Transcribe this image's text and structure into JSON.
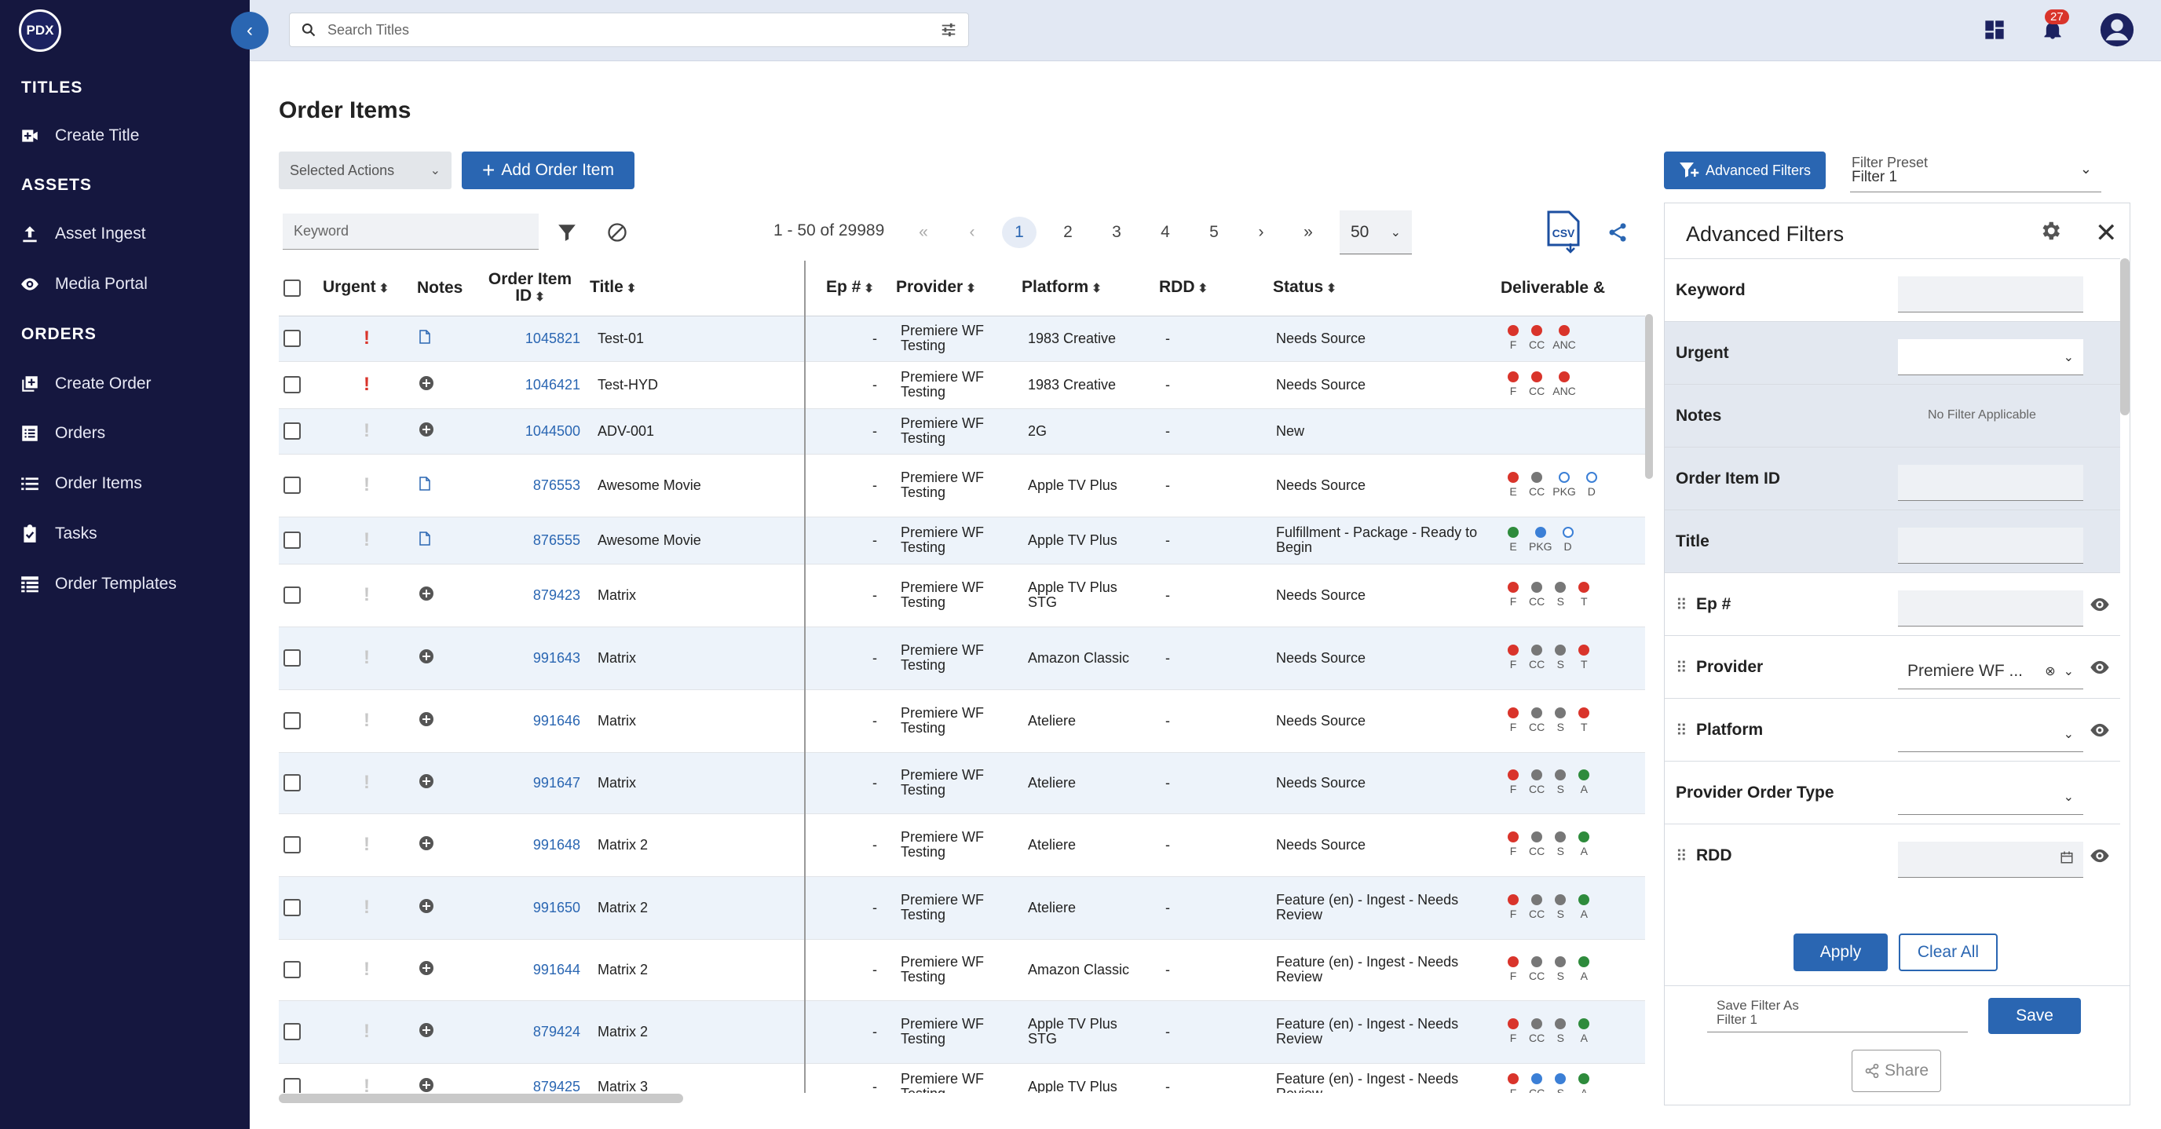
{
  "logo": "PDX",
  "sidebar": {
    "sections": [
      {
        "title": "TITLES",
        "items": [
          {
            "label": "Create Title",
            "icon": "video-add-icon"
          }
        ]
      },
      {
        "title": "ASSETS",
        "items": [
          {
            "label": "Asset Ingest",
            "icon": "upload-icon"
          },
          {
            "label": "Media Portal",
            "icon": "eye-icon"
          }
        ]
      },
      {
        "title": "ORDERS",
        "items": [
          {
            "label": "Create Order",
            "icon": "add-box-icon"
          },
          {
            "label": "Orders",
            "icon": "list-box-icon"
          },
          {
            "label": "Order Items",
            "icon": "list-icon"
          },
          {
            "label": "Tasks",
            "icon": "clipboard-check-icon"
          },
          {
            "label": "Order Templates",
            "icon": "table-list-icon"
          }
        ]
      }
    ]
  },
  "topbar": {
    "search_placeholder": "Search Titles",
    "notification_count": "27"
  },
  "page": {
    "title": "Order Items",
    "selected_actions": "Selected Actions",
    "add_order_item": "Add Order Item",
    "advanced_filters": "Advanced Filters",
    "filter_preset_label": "Filter Preset",
    "filter_preset_value": "Filter 1"
  },
  "toolbar": {
    "keyword_placeholder": "Keyword",
    "range": "1 - 50 of 29989",
    "pages": [
      "«",
      "‹",
      "1",
      "2",
      "3",
      "4",
      "5",
      "›",
      "»"
    ],
    "page_size": "50",
    "csv_label": "CSV"
  },
  "table": {
    "headers": {
      "urgent": "Urgent",
      "notes": "Notes",
      "order_item_id": "Order Item ID",
      "title": "Title",
      "ep": "Ep #",
      "provider": "Provider",
      "platform": "Platform",
      "rdd": "RDD",
      "status": "Status",
      "deliverable": "Deliverable &"
    },
    "rows": [
      {
        "urgent": true,
        "note": "doc",
        "id": "1045821",
        "title": "Test-01",
        "ep": "-",
        "provider": "Premiere WF Testing",
        "platform": "1983 Creative",
        "rdd": "-",
        "status": "Needs Source",
        "deliv": [
          [
            "red",
            "F"
          ],
          [
            "red",
            "CC"
          ],
          [
            "red",
            "ANC"
          ]
        ]
      },
      {
        "urgent": true,
        "note": "add",
        "id": "1046421",
        "title": "Test-HYD",
        "ep": "-",
        "provider": "Premiere WF Testing",
        "platform": "1983 Creative",
        "rdd": "-",
        "status": "Needs Source",
        "deliv": [
          [
            "red",
            "F"
          ],
          [
            "red",
            "CC"
          ],
          [
            "red",
            "ANC"
          ]
        ]
      },
      {
        "urgent": false,
        "note": "add",
        "id": "1044500",
        "title": "ADV-001",
        "ep": "-",
        "provider": "Premiere WF Testing",
        "platform": "2G",
        "rdd": "-",
        "status": "New",
        "deliv": []
      },
      {
        "urgent": false,
        "note": "doc",
        "id": "876553",
        "title": "Awesome Movie",
        "ep": "-",
        "provider": "Premiere WF Testing",
        "platform": "Apple TV Plus",
        "rdd": "-",
        "status": "Needs Source",
        "deliv": [
          [
            "red",
            "E"
          ],
          [
            "grey",
            "CC"
          ],
          [
            "hollow",
            "PKG"
          ],
          [
            "hollow",
            "D"
          ]
        ]
      },
      {
        "urgent": false,
        "note": "doc",
        "id": "876555",
        "title": "Awesome Movie",
        "ep": "-",
        "provider": "Premiere WF Testing",
        "platform": "Apple TV Plus",
        "rdd": "-",
        "status": "Fulfillment - Package - Ready to Begin",
        "deliv": [
          [
            "green",
            "E"
          ],
          [
            "blue",
            "PKG"
          ],
          [
            "hollow",
            "D"
          ]
        ]
      },
      {
        "urgent": false,
        "note": "add",
        "id": "879423",
        "title": "Matrix",
        "ep": "-",
        "provider": "Premiere WF Testing",
        "platform": "Apple TV Plus STG",
        "rdd": "-",
        "status": "Needs Source",
        "deliv": [
          [
            "red",
            "F"
          ],
          [
            "grey",
            "CC"
          ],
          [
            "grey",
            "S"
          ],
          [
            "red",
            "T"
          ]
        ]
      },
      {
        "urgent": false,
        "note": "add",
        "id": "991643",
        "title": "Matrix",
        "ep": "-",
        "provider": "Premiere WF Testing",
        "platform": "Amazon Classic",
        "rdd": "-",
        "status": "Needs Source",
        "deliv": [
          [
            "red",
            "F"
          ],
          [
            "grey",
            "CC"
          ],
          [
            "grey",
            "S"
          ],
          [
            "red",
            "T"
          ]
        ]
      },
      {
        "urgent": false,
        "note": "add",
        "id": "991646",
        "title": "Matrix",
        "ep": "-",
        "provider": "Premiere WF Testing",
        "platform": "Ateliere",
        "rdd": "-",
        "status": "Needs Source",
        "deliv": [
          [
            "red",
            "F"
          ],
          [
            "grey",
            "CC"
          ],
          [
            "grey",
            "S"
          ],
          [
            "red",
            "T"
          ]
        ]
      },
      {
        "urgent": false,
        "note": "add",
        "id": "991647",
        "title": "Matrix",
        "ep": "-",
        "provider": "Premiere WF Testing",
        "platform": "Ateliere",
        "rdd": "-",
        "status": "Needs Source",
        "deliv": [
          [
            "red",
            "F"
          ],
          [
            "grey",
            "CC"
          ],
          [
            "grey",
            "S"
          ],
          [
            "green",
            "A"
          ]
        ]
      },
      {
        "urgent": false,
        "note": "add",
        "id": "991648",
        "title": "Matrix 2",
        "ep": "-",
        "provider": "Premiere WF Testing",
        "platform": "Ateliere",
        "rdd": "-",
        "status": "Needs Source",
        "deliv": [
          [
            "red",
            "F"
          ],
          [
            "grey",
            "CC"
          ],
          [
            "grey",
            "S"
          ],
          [
            "green",
            "A"
          ]
        ]
      },
      {
        "urgent": false,
        "note": "add",
        "id": "991650",
        "title": "Matrix 2",
        "ep": "-",
        "provider": "Premiere WF Testing",
        "platform": "Ateliere",
        "rdd": "-",
        "status": "Feature (en) - Ingest - Needs Review",
        "deliv": [
          [
            "red",
            "F"
          ],
          [
            "grey",
            "CC"
          ],
          [
            "grey",
            "S"
          ],
          [
            "green",
            "A"
          ]
        ]
      },
      {
        "urgent": false,
        "note": "add",
        "id": "991644",
        "title": "Matrix 2",
        "ep": "-",
        "provider": "Premiere WF Testing",
        "platform": "Amazon Classic",
        "rdd": "-",
        "status": "Feature (en) - Ingest - Needs Review",
        "deliv": [
          [
            "red",
            "F"
          ],
          [
            "grey",
            "CC"
          ],
          [
            "grey",
            "S"
          ],
          [
            "green",
            "A"
          ]
        ]
      },
      {
        "urgent": false,
        "note": "add",
        "id": "879424",
        "title": "Matrix 2",
        "ep": "-",
        "provider": "Premiere WF Testing",
        "platform": "Apple TV Plus STG",
        "rdd": "-",
        "status": "Feature (en) - Ingest - Needs Review",
        "deliv": [
          [
            "red",
            "F"
          ],
          [
            "grey",
            "CC"
          ],
          [
            "grey",
            "S"
          ],
          [
            "green",
            "A"
          ]
        ]
      },
      {
        "urgent": false,
        "note": "add",
        "id": "879425",
        "title": "Matrix 3",
        "ep": "-",
        "provider": "Premiere WF Testing",
        "platform": "Apple TV Plus",
        "rdd": "-",
        "status": "Feature (en) - Ingest - Needs Review",
        "deliv": [
          [
            "red",
            "F"
          ],
          [
            "blue",
            "CC"
          ],
          [
            "blue",
            "S"
          ],
          [
            "green",
            "A"
          ]
        ]
      }
    ]
  },
  "adv_panel": {
    "title": "Advanced Filters",
    "rows": [
      {
        "label": "Keyword",
        "kind": "input",
        "shade": false,
        "drag": false,
        "eye": false
      },
      {
        "label": "Urgent",
        "kind": "select",
        "shade": true,
        "drag": false,
        "eye": false
      },
      {
        "label": "Notes",
        "kind": "noapp",
        "shade": true,
        "drag": false,
        "eye": false,
        "text": "No Filter Applicable"
      },
      {
        "label": "Order Item ID",
        "kind": "input",
        "shade": true,
        "drag": false,
        "eye": false
      },
      {
        "label": "Title",
        "kind": "input",
        "shade": true,
        "drag": false,
        "eye": false
      },
      {
        "label": "Ep #",
        "kind": "input",
        "shade": false,
        "drag": true,
        "eye": true
      },
      {
        "label": "Provider",
        "kind": "chip",
        "shade": false,
        "drag": true,
        "eye": true,
        "value": "Premiere WF ..."
      },
      {
        "label": "Platform",
        "kind": "select",
        "shade": false,
        "drag": true,
        "eye": true
      },
      {
        "label": "Provider Order Type",
        "kind": "select",
        "shade": false,
        "drag": false,
        "eye": false
      },
      {
        "label": "RDD",
        "kind": "date",
        "shade": false,
        "drag": true,
        "eye": true
      }
    ],
    "apply": "Apply",
    "clear_all": "Clear All",
    "save_filter_label": "Save Filter As",
    "save_filter_value": "Filter 1",
    "save": "Save",
    "share": "Share"
  },
  "colors": {
    "sidebar": "#15173f",
    "accent": "#2a66b2",
    "urgent": "#d9342b"
  }
}
